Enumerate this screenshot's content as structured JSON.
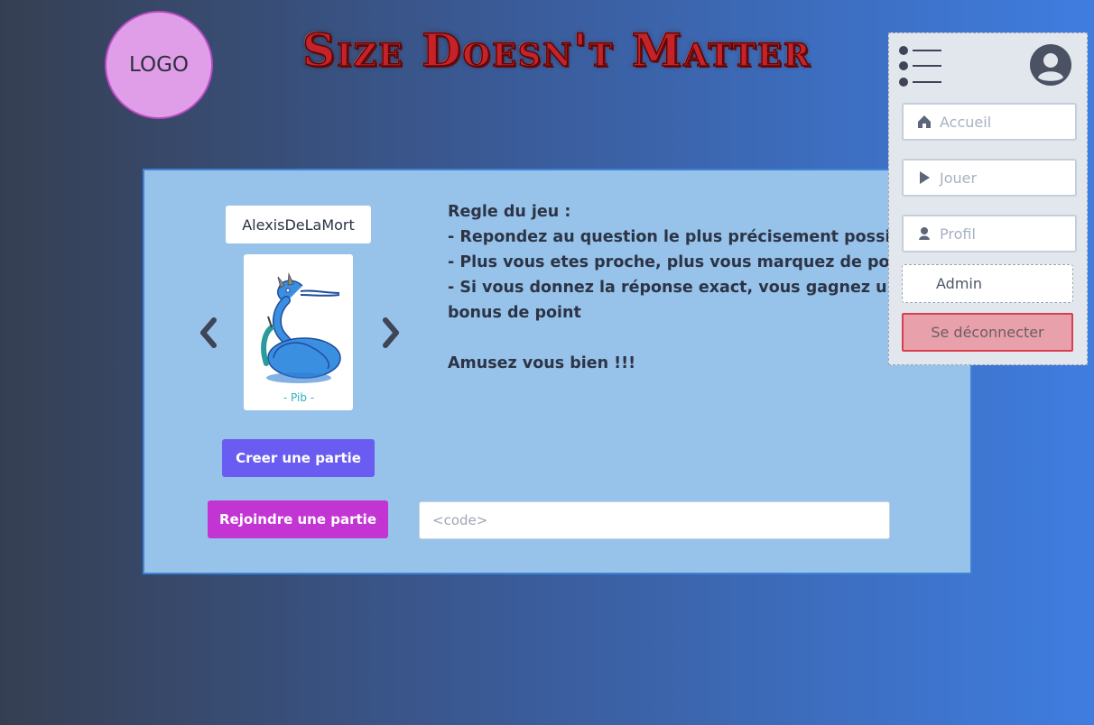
{
  "header": {
    "logo_text": "LOGO",
    "site_title": "Size Doesn't Matter"
  },
  "player": {
    "name": "AlexisDeLaMort",
    "avatar_icon": "blue-dragon-avatar",
    "avatar_signature": "- Pib -"
  },
  "rules": {
    "title": "Regle du jeu :",
    "line1": "- Repondez au question le plus précisement possible",
    "line2": "- Plus vous etes proche, plus vous marquez de points",
    "line3a": "- Si vous donnez la réponse exact, vous gagnez un",
    "line3b": "bonus de point",
    "closing": "Amusez vous bien !!!"
  },
  "actions": {
    "create_label": "Creer une partie",
    "join_label": "Rejoindre une partie",
    "code_placeholder": "<code>"
  },
  "menu": {
    "items": [
      {
        "label": "Accueil",
        "icon": "home-icon"
      },
      {
        "label": "Jouer",
        "icon": "play-icon"
      },
      {
        "label": "Profil",
        "icon": "user-icon"
      }
    ],
    "admin_label": "Admin",
    "logout_label": "Se déconnecter"
  },
  "colors": {
    "card_bg": "#97c3ea",
    "create_button": "#6a5cf0",
    "join_button": "#c335d2",
    "logout_bg": "#e8a0aa",
    "logout_border": "#d8404f",
    "logo_bg": "#e09ee8",
    "title_red": "#c4232a"
  }
}
